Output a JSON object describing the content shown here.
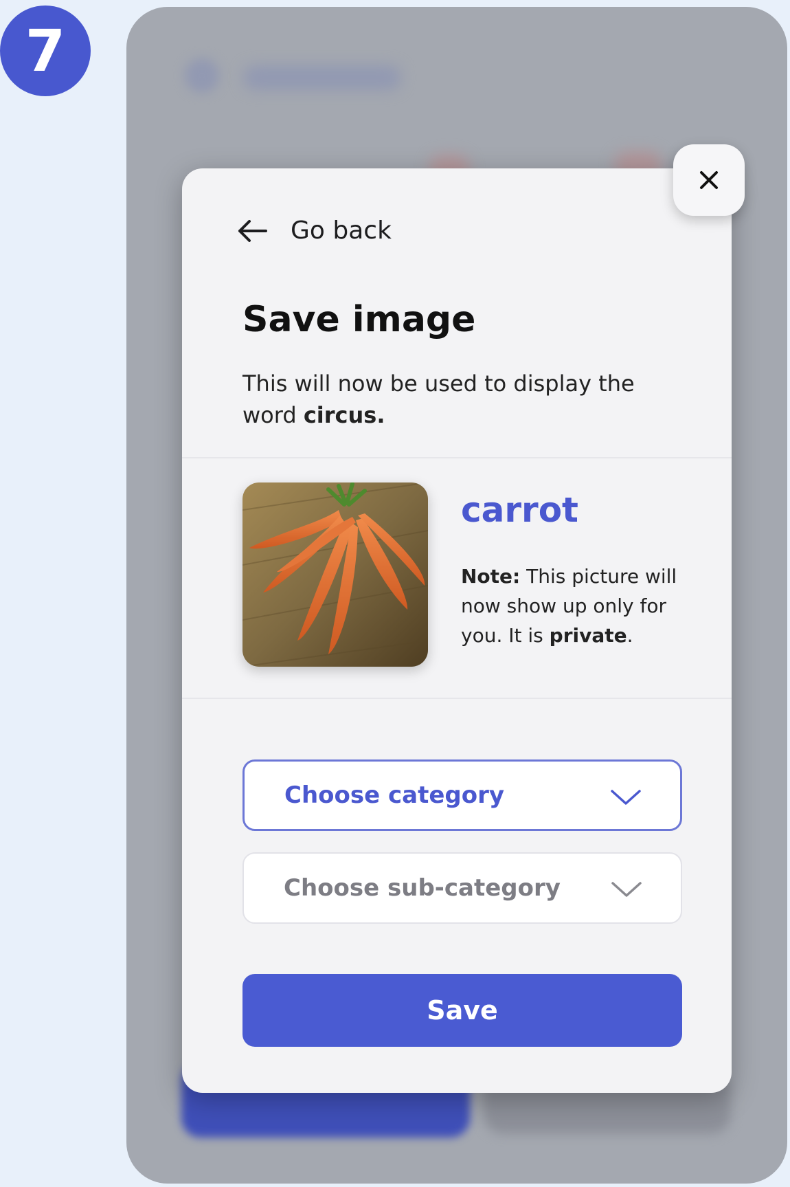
{
  "step": {
    "number": "7"
  },
  "modal": {
    "back_label": "Go back",
    "title": "Save image",
    "description_prefix": "This will now be used to display the word ",
    "description_word": "circus.",
    "image_word": "carrot",
    "note_label": "Note:",
    "note_text": " This picture will now show up only for you. It is ",
    "note_emph": "private",
    "note_end": ".",
    "category_placeholder": "Choose category",
    "subcategory_placeholder": "Choose sub-category",
    "save_label": "Save"
  },
  "icons": {
    "back": "arrow-left-icon",
    "close": "close-icon",
    "dropdown": "chevron-down-icon"
  },
  "colors": {
    "accent": "#4a5bd2",
    "badge": "#4858cf",
    "backdrop": "#a4a8b0",
    "modal_bg": "#f3f3f5"
  }
}
